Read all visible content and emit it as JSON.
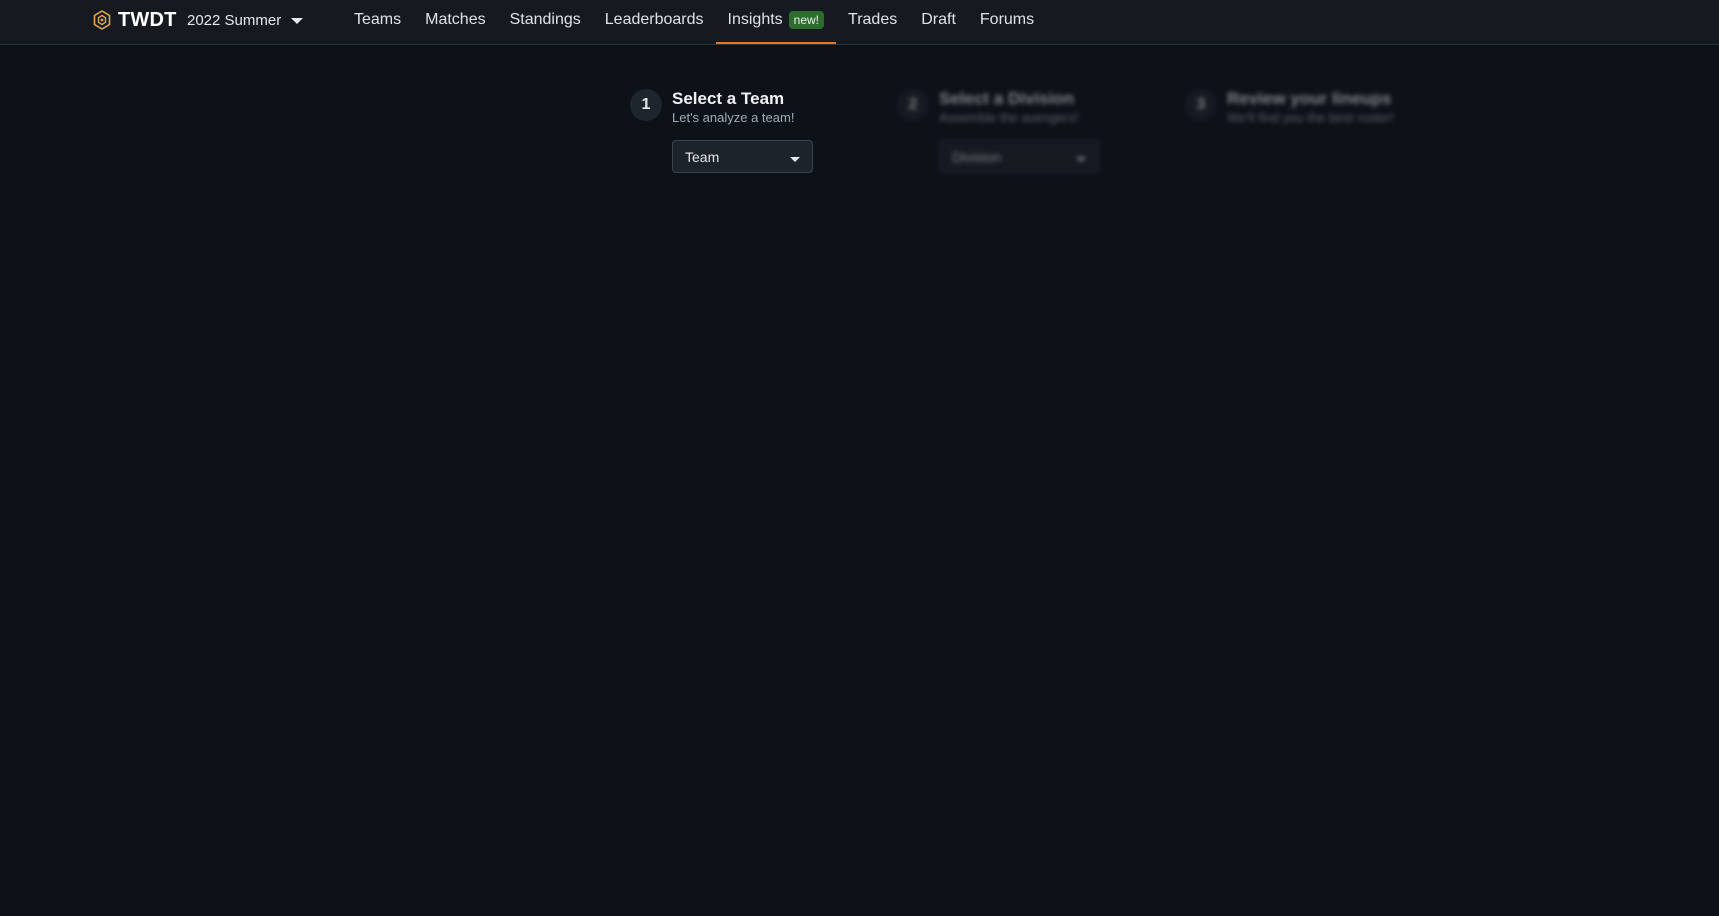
{
  "nav": {
    "brand": "TWDT",
    "season": "2022 Summer",
    "items": [
      {
        "label": "Teams"
      },
      {
        "label": "Matches"
      },
      {
        "label": "Standings"
      },
      {
        "label": "Leaderboards"
      },
      {
        "label": "Insights",
        "badge": "new!"
      },
      {
        "label": "Trades"
      },
      {
        "label": "Draft"
      },
      {
        "label": "Forums"
      }
    ],
    "active": "Insights"
  },
  "steps": [
    {
      "number": "1",
      "title": "Select a Team",
      "subtitle": "Let's analyze a team!",
      "select_value": "Team"
    },
    {
      "number": "2",
      "title": "Select a Division",
      "subtitle": "Assemble the avengers!",
      "select_value": "Division"
    },
    {
      "number": "3",
      "title": "Review your lineups",
      "subtitle": "We'll find you the best roster!"
    }
  ],
  "colors": {
    "background": "#0d1118",
    "navbar": "#151a21",
    "accent": "#e07a2a",
    "badge": "#2e6b2f"
  }
}
